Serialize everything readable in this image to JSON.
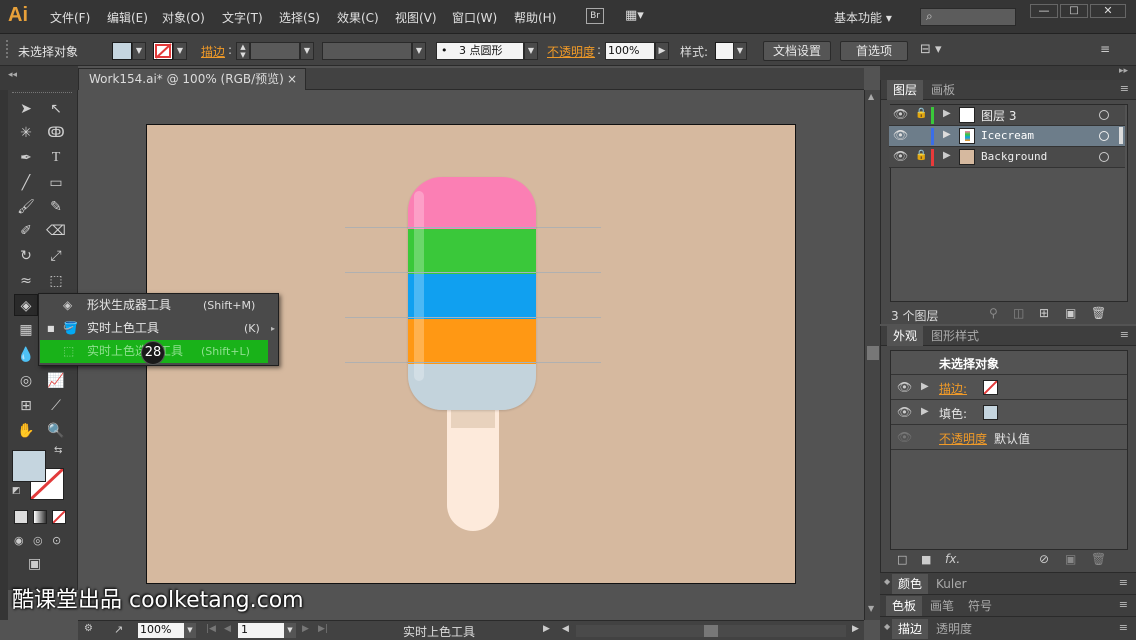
{
  "app": {
    "logo": "Ai"
  },
  "menu": [
    "文件(F)",
    "编辑(E)",
    "对象(O)",
    "文字(T)",
    "选择(S)",
    "效果(C)",
    "视图(V)",
    "窗口(W)",
    "帮助(H)"
  ],
  "menu_extras": {
    "bridge": "Br",
    "workspace": "基本功能"
  },
  "control_bar": {
    "selection": "未选择对象",
    "stroke_label": "描边",
    "brush_value": "3 点圆形",
    "opacity_label": "不透明度",
    "opacity_value": "100%",
    "style_label": "样式",
    "doc_setup": "文档设置",
    "preferences": "首选项"
  },
  "document": {
    "tab_title": "Work154.ai* @ 100% (RGB/预览)",
    "close": "×"
  },
  "flyout": {
    "items": [
      {
        "label": "形状生成器工具",
        "shortcut": "(Shift+M)"
      },
      {
        "label": "实时上色工具",
        "shortcut": "(K)"
      },
      {
        "label": "实时上色选择工具",
        "shortcut": "(Shift+L)"
      }
    ],
    "step_badge": "28"
  },
  "layers_panel": {
    "tabs": [
      "图层",
      "画板"
    ],
    "layers": [
      {
        "name": "图层 3",
        "color": "#3ac83a"
      },
      {
        "name": "Icecream",
        "color": "#3a6ee8"
      },
      {
        "name": "Background",
        "color": "#e83a3a"
      }
    ],
    "count": "3 个图层"
  },
  "appearance_panel": {
    "tabs": [
      "外观",
      "图形样式"
    ],
    "title": "未选择对象",
    "stroke_label": "描边:",
    "fill_label": "填色:",
    "opacity_label": "不透明度",
    "opacity_value": "默认值"
  },
  "collapsed_panels": [
    [
      "颜色",
      "Kuler"
    ],
    [
      "色板",
      "画笔",
      "符号"
    ],
    [
      "描边",
      "透明度"
    ]
  ],
  "status": {
    "zoom": "100%",
    "page": "1",
    "tool": "实时上色工具"
  },
  "watermark": "酷课堂出品 coolketang.com",
  "colors": {
    "accent_orange": "#f09a28",
    "flyout_highlight": "#19b219",
    "artboard": "#d6b99f"
  }
}
